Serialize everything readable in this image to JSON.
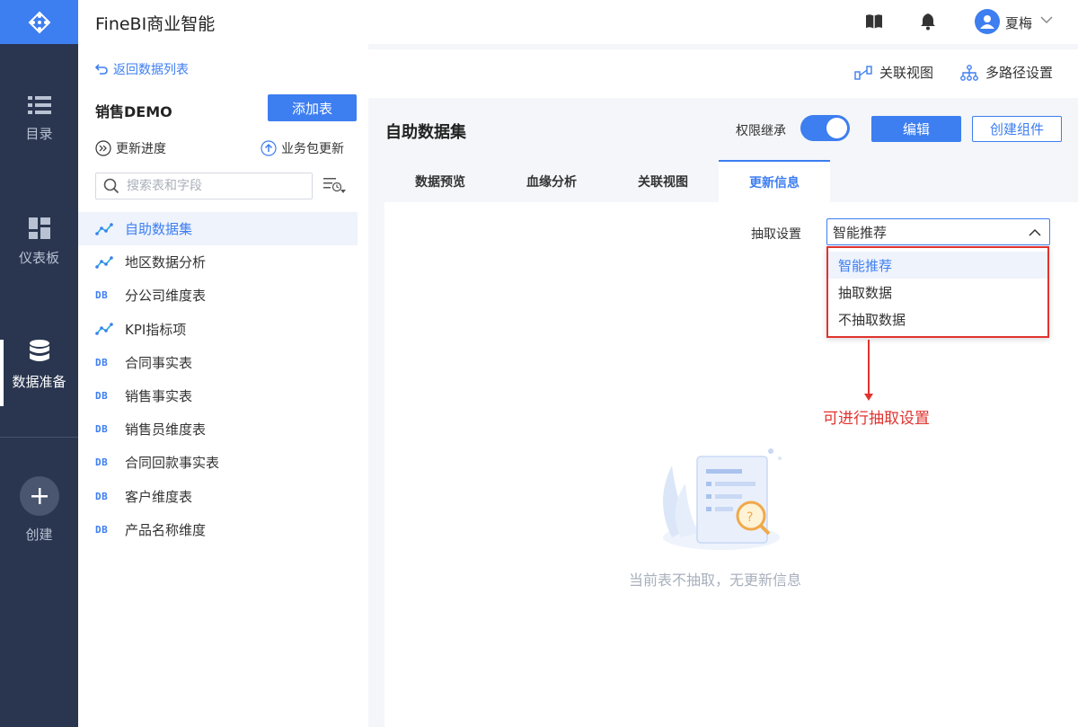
{
  "app": {
    "title": "FineBI商业智能",
    "user_name": "夏梅"
  },
  "nav": {
    "items": [
      {
        "label": "目录",
        "icon": "list-icon"
      },
      {
        "label": "仪表板",
        "icon": "dashboard-icon"
      },
      {
        "label": "数据准备",
        "icon": "database-icon",
        "active": true
      }
    ],
    "create_label": "创建"
  },
  "sidebar": {
    "back_label": "返回数据列表",
    "package_name": "销售DEMO",
    "add_table_label": "添加表",
    "update_progress_label": "更新进度",
    "package_update_label": "业务包更新",
    "search_placeholder": "搜索表和字段",
    "tables": [
      {
        "name": "自助数据集",
        "type": "self-service",
        "selected": true
      },
      {
        "name": "地区数据分析",
        "type": "self-service"
      },
      {
        "name": "分公司维度表",
        "type": "db"
      },
      {
        "name": "KPI指标项",
        "type": "self-service"
      },
      {
        "name": "合同事实表",
        "type": "db"
      },
      {
        "name": "销售事实表",
        "type": "db"
      },
      {
        "name": "销售员维度表",
        "type": "db"
      },
      {
        "name": "合同回款事实表",
        "type": "db"
      },
      {
        "name": "客户维度表",
        "type": "db"
      },
      {
        "name": "产品名称维度",
        "type": "db"
      }
    ],
    "db_badge": "DB"
  },
  "toolbar": {
    "relation_view_label": "关联视图",
    "multipath_label": "多路径设置"
  },
  "dataset": {
    "title": "自助数据集",
    "permission_label": "权限继承",
    "permission_on": true,
    "edit_label": "编辑",
    "create_component_label": "创建组件"
  },
  "tabs": [
    {
      "label": "数据预览"
    },
    {
      "label": "血缘分析"
    },
    {
      "label": "关联视图"
    },
    {
      "label": "更新信息",
      "active": true
    }
  ],
  "update_info": {
    "extract_label": "抽取设置",
    "extract_value": "智能推荐",
    "extract_options": [
      "智能推荐",
      "抽取数据",
      "不抽取数据"
    ],
    "annotation": "可进行抽取设置",
    "empty_message": "当前表不抽取，无更新信息"
  },
  "colors": {
    "accent": "#3d7ef0",
    "nav_bg": "#2a3650",
    "annotation": "#e0332f"
  }
}
